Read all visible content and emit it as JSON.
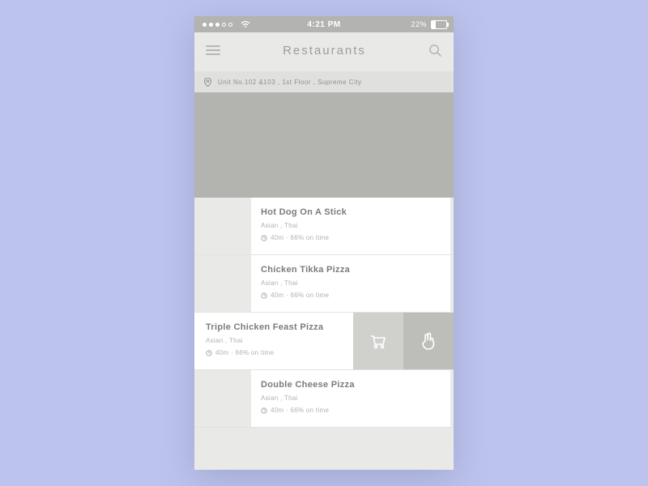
{
  "status": {
    "time": "4:21 PM",
    "battery_pct": "22%"
  },
  "nav": {
    "title": "Restaurants"
  },
  "address": "Unit No.102 &103 , 1st Floor , Supreme City",
  "items": [
    {
      "name": "Hot Dog On A Stick",
      "cuisine": "Asian , Thai",
      "stat": "40m · 66% on time",
      "swiped": false
    },
    {
      "name": "Chicken Tikka Pizza",
      "cuisine": "Asian , Thai",
      "stat": "40m · 66% on time",
      "swiped": false
    },
    {
      "name": "Triple Chicken Feast Pizza",
      "cuisine": "Asian , Thai",
      "stat": "40m · 66% on time",
      "swiped": true
    },
    {
      "name": "Double Cheese Pizza",
      "cuisine": "Asian , Thai",
      "stat": "40m · 66% on time",
      "swiped": false
    }
  ]
}
